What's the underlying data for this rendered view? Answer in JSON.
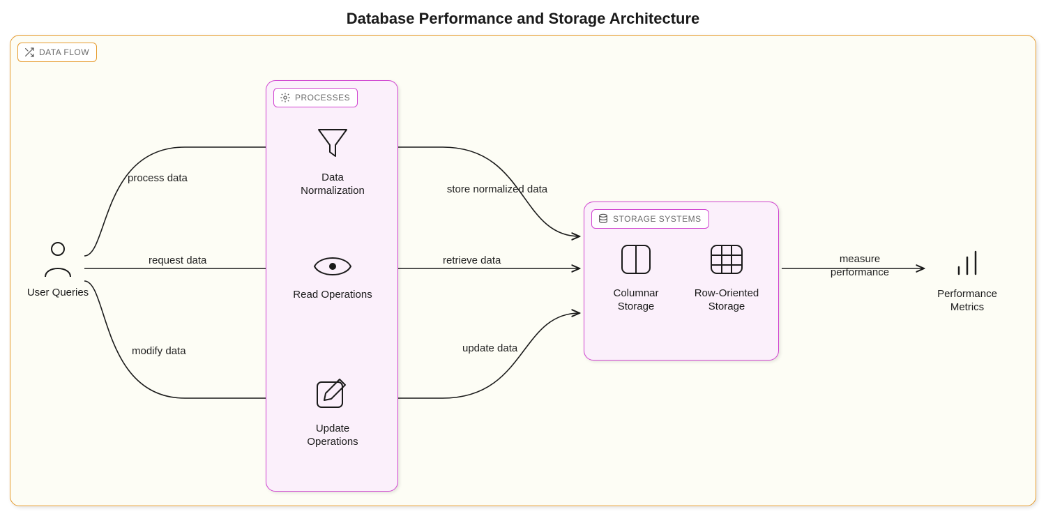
{
  "title": "Database Performance and Storage Architecture",
  "badges": {
    "dataflow": "DATA FLOW",
    "processes": "PROCESSES",
    "storage": "STORAGE SYSTEMS"
  },
  "nodes": {
    "user": "User Queries",
    "normalize": "Data Normalization",
    "read": "Read Operations",
    "update": "Update Operations",
    "columnar": "Columnar Storage",
    "row": "Row-Oriented Storage",
    "metrics": "Performance Metrics"
  },
  "edges": {
    "process_data": "process data",
    "request_data": "request data",
    "modify_data": "modify data",
    "store_normalized": "store normalized data",
    "retrieve_data": "retrieve data",
    "update_data": "update data",
    "measure_perf": "measure performance"
  }
}
